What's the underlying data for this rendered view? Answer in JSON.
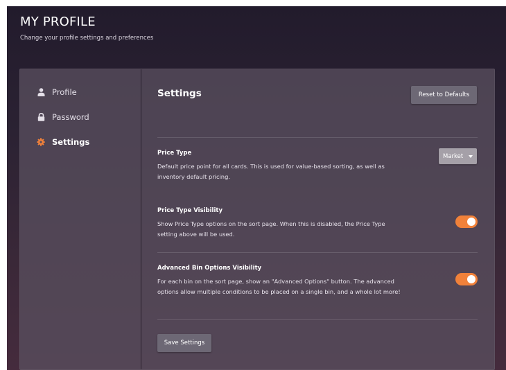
{
  "header": {
    "title": "MY PROFILE",
    "subtitle": "Change your profile settings and preferences"
  },
  "sidebar": {
    "items": [
      {
        "label": "Profile",
        "icon": "user-icon",
        "active": false
      },
      {
        "label": "Password",
        "icon": "lock-icon",
        "active": false
      },
      {
        "label": "Settings",
        "icon": "gear-icon",
        "active": true
      }
    ]
  },
  "content": {
    "title": "Settings",
    "reset_label": "Reset to Defaults",
    "save_label": "Save Settings",
    "settings": [
      {
        "label": "Price Type",
        "description": "Default price point for all cards. This is used for value-based sorting, as well as inventory default pricing.",
        "control": "dropdown",
        "value": "Market"
      },
      {
        "label": "Price Type Visibility",
        "description": "Show Price Type options on the sort page. When this is disabled, the Price Type setting above will be used.",
        "control": "toggle",
        "enabled": true
      },
      {
        "label": "Advanced Bin Options Visibility",
        "description": "For each bin on the sort page, show an \"Advanced Options\" button. The advanced options allow multiple conditions to be placed on a single bin, and a whole lot more!",
        "control": "toggle",
        "enabled": true
      }
    ]
  },
  "colors": {
    "accent": "#f0813a",
    "button": "#6d6875",
    "panel": "#584e5e",
    "active_icon": "#f0813a"
  }
}
